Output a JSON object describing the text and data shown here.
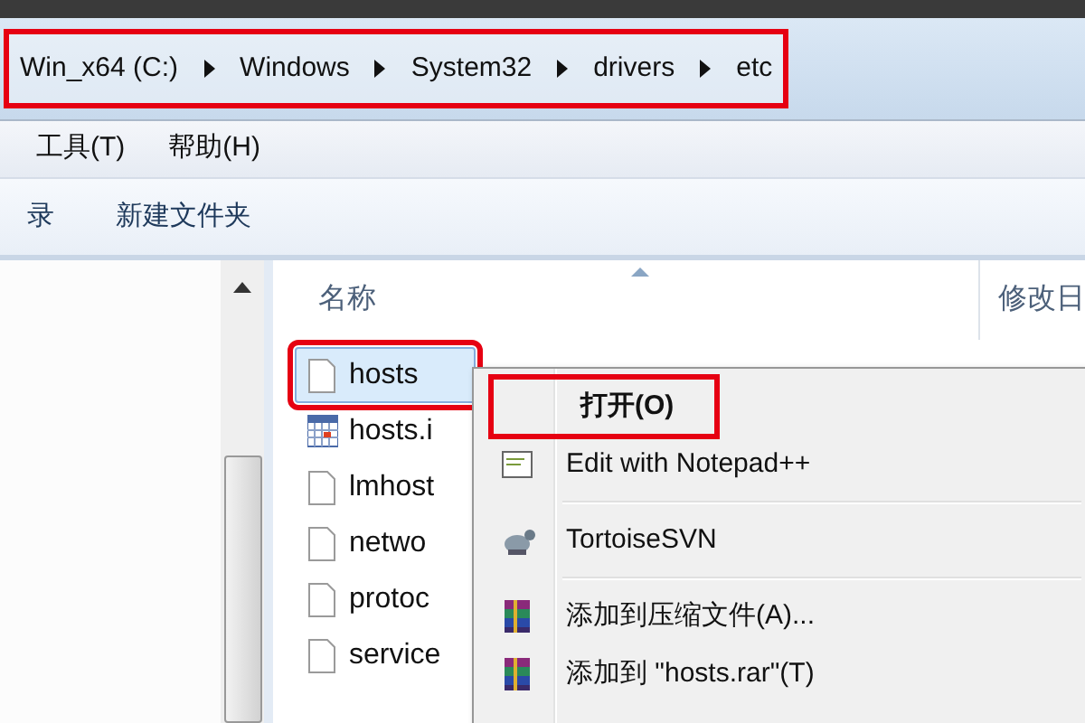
{
  "address_bar": {
    "crumbs": [
      "Win_x64 (C:)",
      "Windows",
      "System32",
      "drivers",
      "etc"
    ],
    "red_box": true
  },
  "menu_bar": [
    "工具(T)",
    "帮助(H)"
  ],
  "toolbar": [
    "录",
    "新建文件夹"
  ],
  "columns": [
    "名称",
    "修改日"
  ],
  "files": [
    {
      "name": "hosts",
      "kind": "text",
      "selected": true,
      "red_box": true
    },
    {
      "name": "hosts.i",
      "kind": "calendar",
      "selected": false,
      "red_box": false
    },
    {
      "name": "lmhost",
      "kind": "text",
      "selected": false,
      "red_box": false
    },
    {
      "name": "netwo",
      "kind": "text",
      "selected": false,
      "red_box": false
    },
    {
      "name": "protoc",
      "kind": "text",
      "selected": false,
      "red_box": false
    },
    {
      "name": "service",
      "kind": "text",
      "selected": false,
      "red_box": false
    }
  ],
  "context_menu": [
    {
      "label": "打开(O)",
      "kind": "open",
      "red_box": true
    },
    {
      "label": "Edit with Notepad++",
      "kind": "notepad",
      "red_box": false
    },
    {
      "kind": "separator"
    },
    {
      "label": "TortoiseSVN",
      "kind": "svn",
      "red_box": false
    },
    {
      "kind": "separator"
    },
    {
      "label": "添加到压缩文件(A)...",
      "kind": "archive",
      "red_box": false
    },
    {
      "label": "添加到 \"hosts.rar\"(T)",
      "kind": "archive",
      "red_box": false
    }
  ]
}
